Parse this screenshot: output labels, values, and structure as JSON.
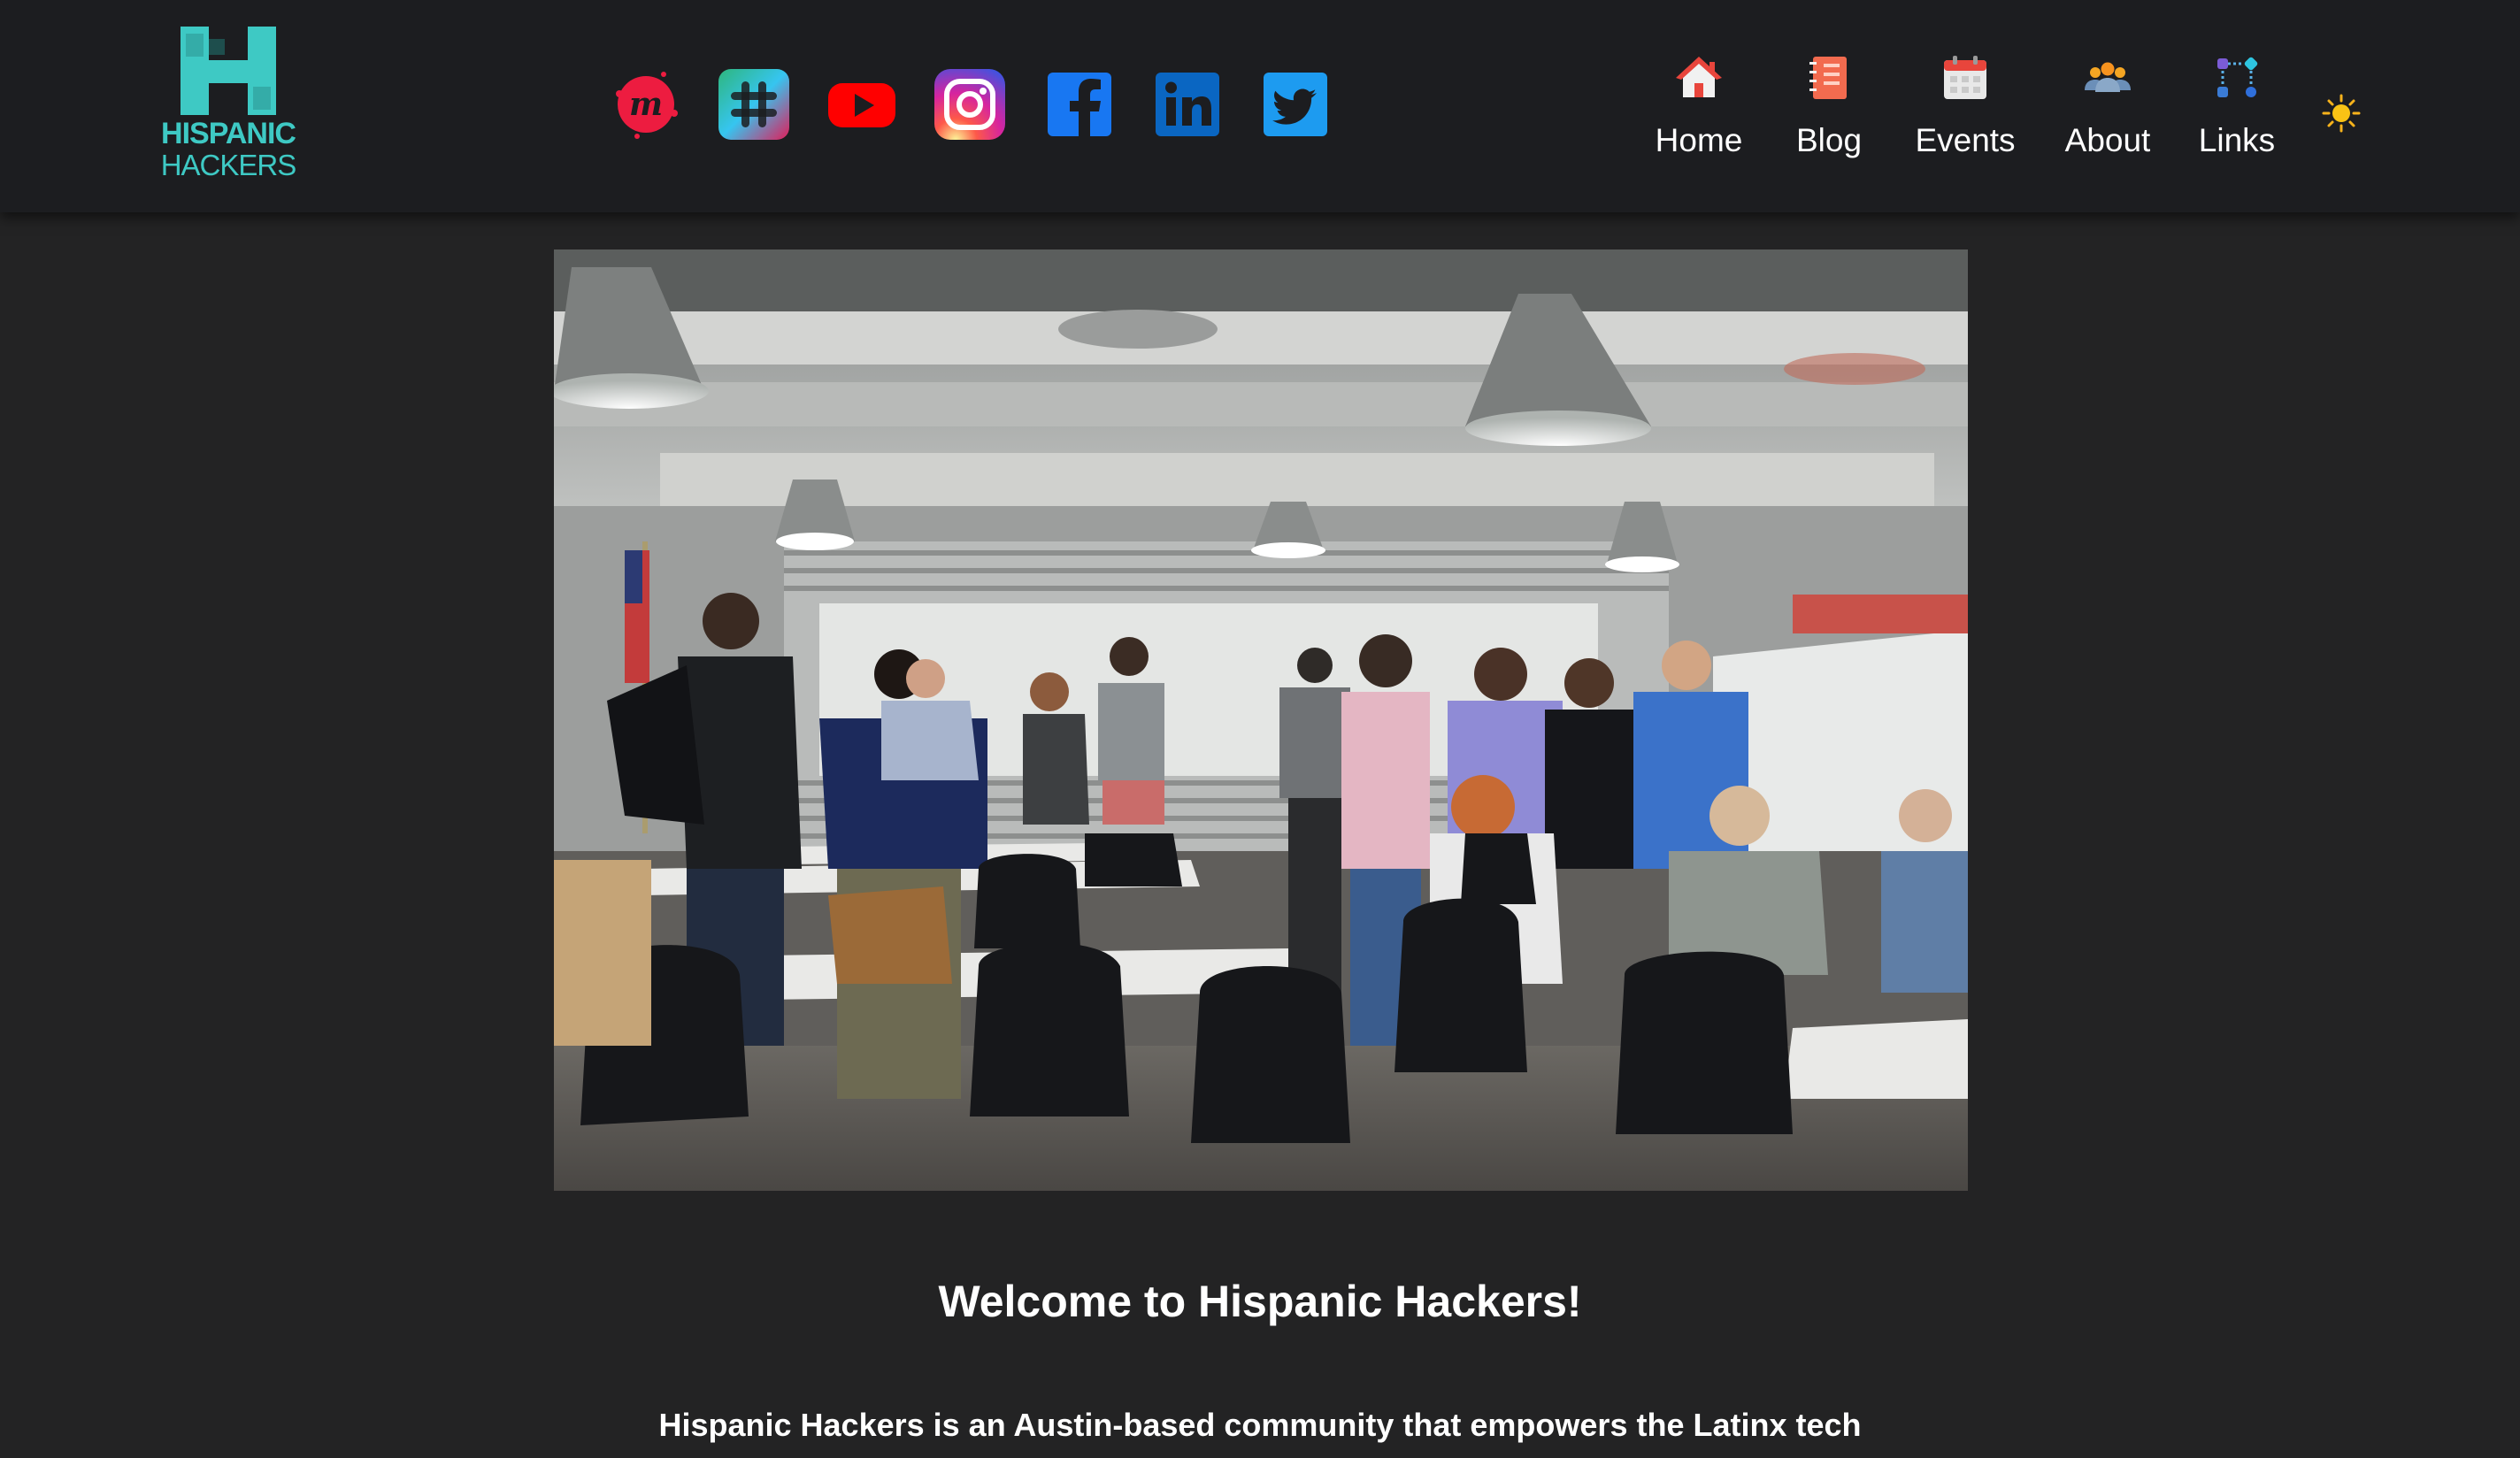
{
  "header": {
    "logo": {
      "line1": "HISPANIC",
      "line2": "HACKERS",
      "color": "#3ec9c4"
    },
    "social_links": [
      {
        "name": "meetup",
        "icon": "meetup-icon",
        "color": "#ed1c40"
      },
      {
        "name": "slack",
        "icon": "slack-icon",
        "color": "#36c5f0"
      },
      {
        "name": "youtube",
        "icon": "youtube-icon",
        "color": "#ff0000"
      },
      {
        "name": "instagram",
        "icon": "instagram-icon",
        "color": "#d6249f"
      },
      {
        "name": "facebook",
        "icon": "facebook-icon",
        "color": "#1877f2"
      },
      {
        "name": "linkedin",
        "icon": "linkedin-icon",
        "color": "#0a66c2"
      },
      {
        "name": "twitter",
        "icon": "twitter-icon",
        "color": "#1d9bf0"
      }
    ],
    "nav": [
      {
        "label": "Home",
        "icon": "house-icon"
      },
      {
        "label": "Blog",
        "icon": "notebook-icon"
      },
      {
        "label": "Events",
        "icon": "calendar-icon"
      },
      {
        "label": "About",
        "icon": "people-icon"
      },
      {
        "label": "Links",
        "icon": "workflow-icon"
      }
    ],
    "theme_toggle_icon": "sun-icon"
  },
  "hero": {
    "image": "group-photo-whiteboard-meetup"
  },
  "main": {
    "welcome_title": "Welcome to Hispanic Hackers!",
    "intro_text": "Hispanic Hackers is an Austin-based community that empowers the Latinx tech"
  }
}
